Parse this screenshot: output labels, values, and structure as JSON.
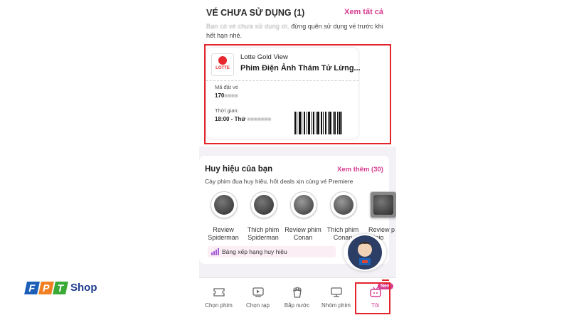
{
  "tickets": {
    "title": "VÉ CHƯA SỬ DỤNG (1)",
    "see_all": "Xem tất cả",
    "note_blurred": "Bạn có vé chưa sử dụng ơi,",
    "note_visible": "đừng quên sử dụng vé trước khi hết hạn nhé.",
    "card": {
      "cinema": "Lotte Gold View",
      "movie": "Phim Điện Ảnh Thám Tử Lừng...",
      "logo_text": "LOTTE",
      "booking_label": "Mã đặt vé",
      "booking_code": "170",
      "time_label": "Thời gian:",
      "time_value": "18:00 - Thứ"
    }
  },
  "badges": {
    "title": "Huy hiệu của bạn",
    "see_more": "Xem thêm (30)",
    "subtitle": "Cày phim đua huy hiệu, hốt deals xịn cùng vé Premiere",
    "items": [
      {
        "line1": "Review",
        "line2": "Spiderman"
      },
      {
        "line1": "Thích phim",
        "line2": "Spiderman"
      },
      {
        "line1": "Review phim",
        "line2": "Conan"
      },
      {
        "line1": "Thích phim",
        "line2": "Conan"
      },
      {
        "line1": "Review p",
        "line2": "Minio"
      }
    ],
    "ranking": "Bảng xếp hạng huy hiệu"
  },
  "nav": {
    "items": [
      "Chọn phim",
      "Chọn rạp",
      "Bắp nước",
      "Nhóm phim",
      "Tôi"
    ],
    "new_badge": "New",
    "active_index": 4
  },
  "brand": {
    "letters": [
      "F",
      "P",
      "T"
    ],
    "shop": "Shop",
    "colors": [
      "#1d5fb8",
      "#f08023",
      "#3aa935"
    ]
  },
  "colors": {
    "accent": "#d63b8f",
    "highlight": "#e3242b"
  }
}
